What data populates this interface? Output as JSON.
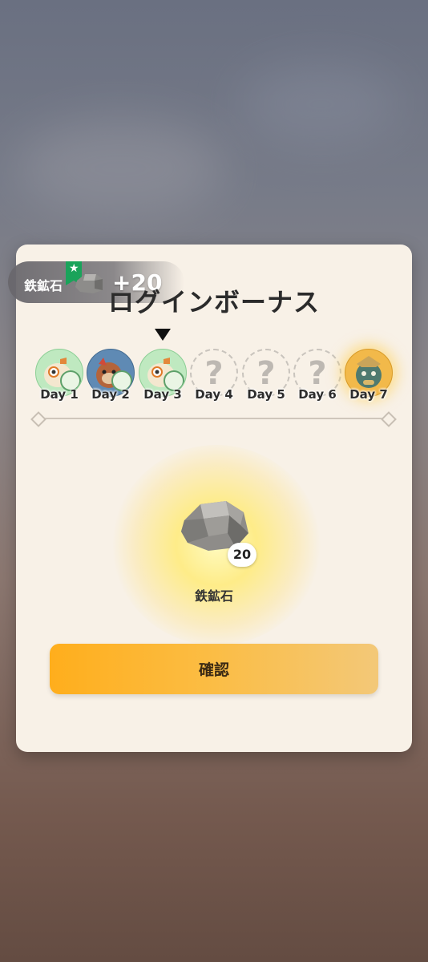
{
  "dialog": {
    "title": "ログインボーナス",
    "confirm_label": "確認"
  },
  "toast": {
    "item_name": "鉄鉱石",
    "amount": "+20",
    "flag_icon": "star-flag-icon",
    "flag_color": "#1aa35a"
  },
  "days": [
    {
      "label": "Day 1",
      "state": "claimed",
      "icon": "bird-creature-icon"
    },
    {
      "label": "Day 2",
      "state": "claimed",
      "icon": "fox-creature-icon"
    },
    {
      "label": "Day 3",
      "state": "current",
      "icon": "bird-creature-icon"
    },
    {
      "label": "Day 4",
      "state": "locked",
      "icon": "question-mark-icon"
    },
    {
      "label": "Day 5",
      "state": "locked",
      "icon": "question-mark-icon"
    },
    {
      "label": "Day 6",
      "state": "locked",
      "icon": "question-mark-icon"
    },
    {
      "label": "Day 7",
      "state": "special",
      "icon": "armored-creature-icon"
    }
  ],
  "reward": {
    "name": "鉄鉱石",
    "count": "20",
    "icon": "iron-ore-icon"
  },
  "colors": {
    "accent": "#ffae1c",
    "panel": "#f8f1e7"
  }
}
